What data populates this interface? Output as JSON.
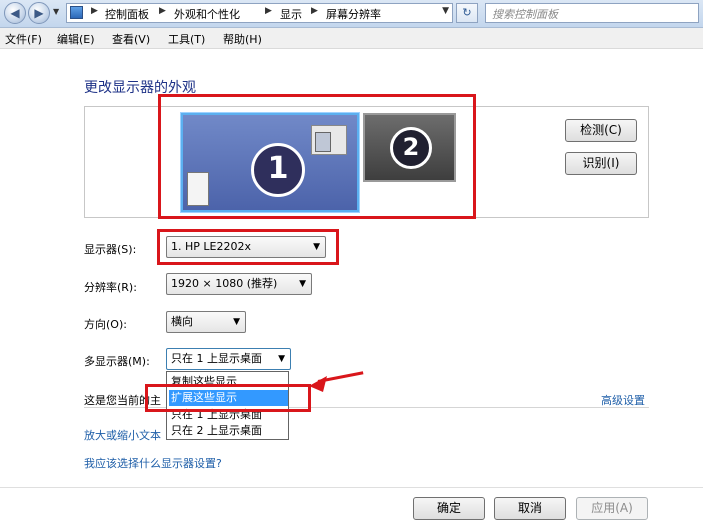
{
  "address_bar": {
    "crumbs": [
      "控制面板",
      "外观和个性化",
      "显示",
      "屏幕分辨率"
    ],
    "search_placeholder": "搜索控制面板",
    "back_glyph": "◀",
    "forward_glyph": "▶",
    "dropdown_glyph": "▼",
    "refresh_glyph": "↻"
  },
  "menu": [
    "文件(F)",
    "编辑(E)",
    "查看(V)",
    "工具(T)",
    "帮助(H)"
  ],
  "title": "更改显示器的外观",
  "monitors": {
    "primary_number": "1",
    "secondary_number": "2"
  },
  "buttons": {
    "detect": "检测(C)",
    "identify": "识别(I)",
    "ok": "确定",
    "cancel": "取消",
    "apply": "应用(A)"
  },
  "fields": {
    "display_label": "显示器(S):",
    "display_value": "1. HP LE2202x",
    "resolution_label": "分辨率(R):",
    "resolution_value": "1920 × 1080 (推荐)",
    "orientation_label": "方向(O):",
    "orientation_value": "横向",
    "multi_label": "多显示器(M):",
    "multi_value": "只在 1 上显示桌面"
  },
  "multi_options": [
    "复制这些显示",
    "扩展这些显示",
    "只在 1 上显示桌面",
    "只在 2 上显示桌面"
  ],
  "status_text": "这是您当前的主",
  "links": {
    "advanced": "高级设置",
    "text_size": "放大或缩小文本",
    "which_settings": "我应该选择什么显示器设置?"
  },
  "colors": {
    "title": "#1e3287",
    "link": "#1e5ea8",
    "highlight": "#3399ff",
    "annotation_red": "#d9161b"
  }
}
